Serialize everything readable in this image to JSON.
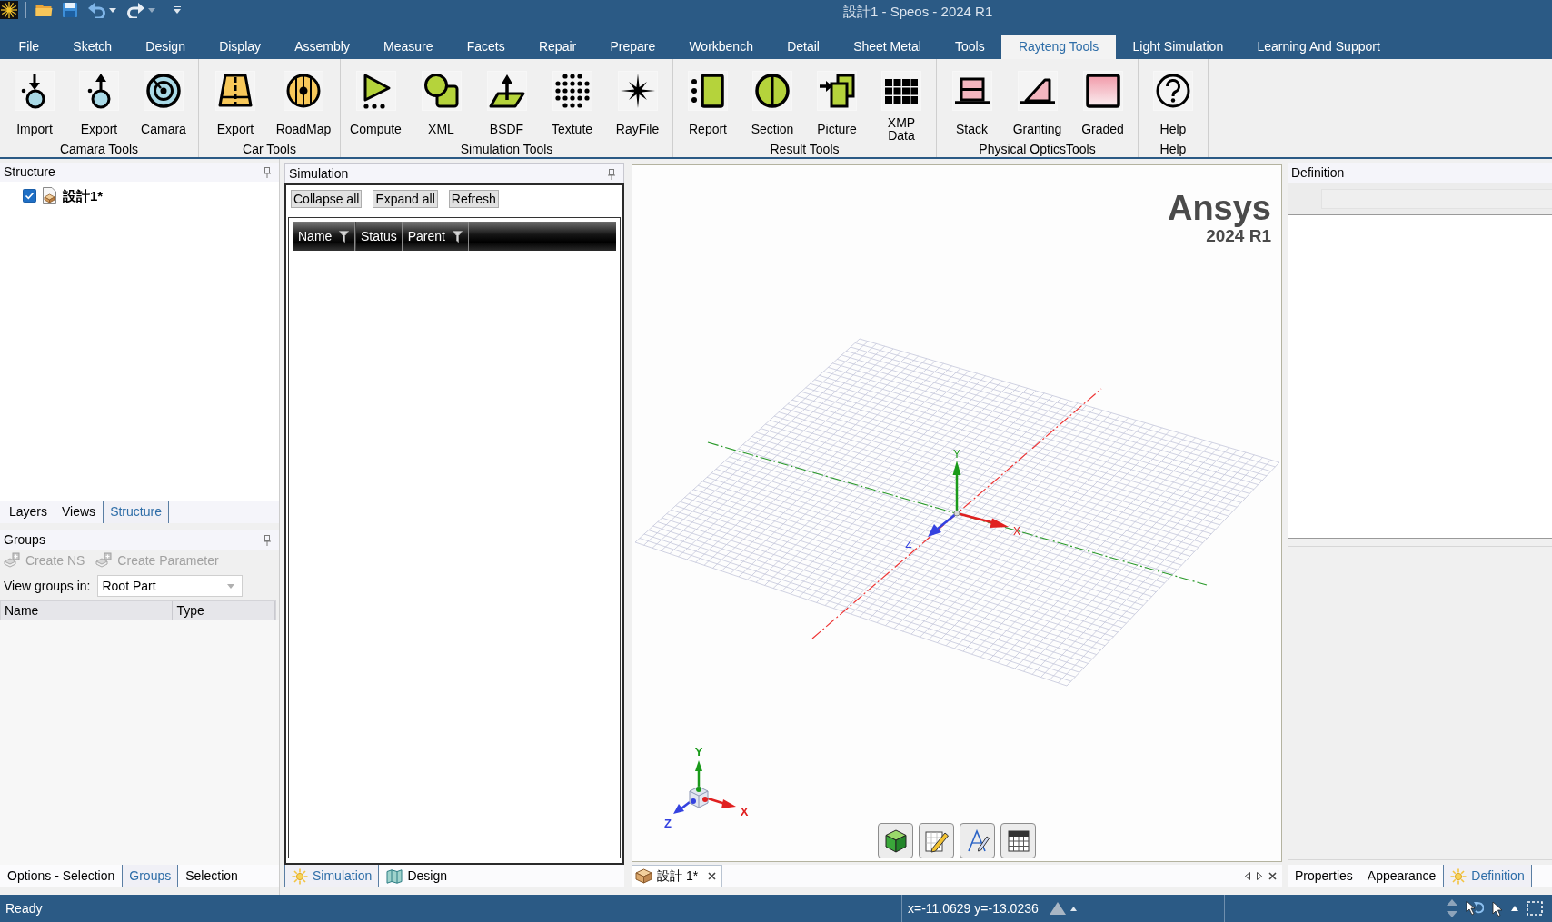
{
  "window": {
    "title": "設計1 - Speos - 2024 R1"
  },
  "menu_tabs": [
    {
      "label": "File",
      "selected": false
    },
    {
      "label": "Sketch",
      "selected": false
    },
    {
      "label": "Design",
      "selected": false
    },
    {
      "label": "Display",
      "selected": false
    },
    {
      "label": "Assembly",
      "selected": false
    },
    {
      "label": "Measure",
      "selected": false
    },
    {
      "label": "Facets",
      "selected": false
    },
    {
      "label": "Repair",
      "selected": false
    },
    {
      "label": "Prepare",
      "selected": false
    },
    {
      "label": "Workbench",
      "selected": false
    },
    {
      "label": "Detail",
      "selected": false
    },
    {
      "label": "Sheet Metal",
      "selected": false
    },
    {
      "label": "Tools",
      "selected": false
    },
    {
      "label": "Rayteng Tools",
      "selected": true
    },
    {
      "label": "Light Simulation",
      "selected": false
    },
    {
      "label": "Learning And Support",
      "selected": false
    }
  ],
  "ribbon_groups": [
    {
      "label": "Camara Tools",
      "buttons": [
        "Import",
        "Export",
        "Camara"
      ]
    },
    {
      "label": "Car Tools",
      "buttons": [
        "Export",
        "RoadMap"
      ]
    },
    {
      "label": "Simulation Tools",
      "buttons": [
        "Compute",
        "XML",
        "BSDF",
        "Textute",
        "RayFile"
      ]
    },
    {
      "label": "Result Tools",
      "buttons": [
        "Report",
        "Section",
        "Picture",
        "XMP Data"
      ]
    },
    {
      "label": "Physical OpticsTools",
      "buttons": [
        "Stack",
        "Granting",
        "Graded"
      ]
    },
    {
      "label": "Help",
      "buttons": [
        "Help"
      ]
    }
  ],
  "structure_panel": {
    "title": "Structure",
    "tree": [
      {
        "label": "設計1*",
        "checked": true
      }
    ],
    "tabs": [
      {
        "label": "Layers",
        "selected": false
      },
      {
        "label": "Views",
        "selected": false
      },
      {
        "label": "Structure",
        "selected": true
      }
    ]
  },
  "groups_panel": {
    "title": "Groups",
    "actions": [
      {
        "label": "Create NS",
        "disabled": true
      },
      {
        "label": "Create Parameter",
        "disabled": true
      }
    ],
    "view_groups": {
      "label": "View groups in:",
      "value": "Root Part"
    },
    "columns": [
      "Name",
      "Type"
    ]
  },
  "left_tabs": [
    {
      "label": "Options - Selection",
      "selected": false
    },
    {
      "label": "Groups",
      "selected": true
    },
    {
      "label": "Selection",
      "selected": false
    }
  ],
  "simulation_panel": {
    "title": "Simulation",
    "buttons": [
      "Collapse all",
      "Expand all",
      "Refresh"
    ],
    "columns": [
      {
        "label": "Name",
        "filter": true
      },
      {
        "label": "Status",
        "filter": false
      },
      {
        "label": "Parent",
        "filter": true
      }
    ]
  },
  "simulation_tabs": [
    {
      "label": "Simulation",
      "selected": true
    },
    {
      "label": "Design",
      "selected": false
    }
  ],
  "viewport": {
    "logo": "Ansys",
    "version": "2024 R1",
    "axis_labels": {
      "x": "X",
      "y": "Y",
      "z": "Z"
    },
    "triad_labels": {
      "x": "X",
      "y": "Y",
      "z": "Z"
    }
  },
  "document_tabs": [
    {
      "label": "設計 1*",
      "selected": true
    }
  ],
  "definition_panel": {
    "title": "Definition"
  },
  "definition_tabs": [
    {
      "label": "Properties",
      "selected": false
    },
    {
      "label": "Appearance",
      "selected": false
    },
    {
      "label": "Definition",
      "selected": true
    }
  ],
  "status_bar": {
    "message": "Ready",
    "coordinates": "x=-11.0629 y=-13.0236"
  }
}
